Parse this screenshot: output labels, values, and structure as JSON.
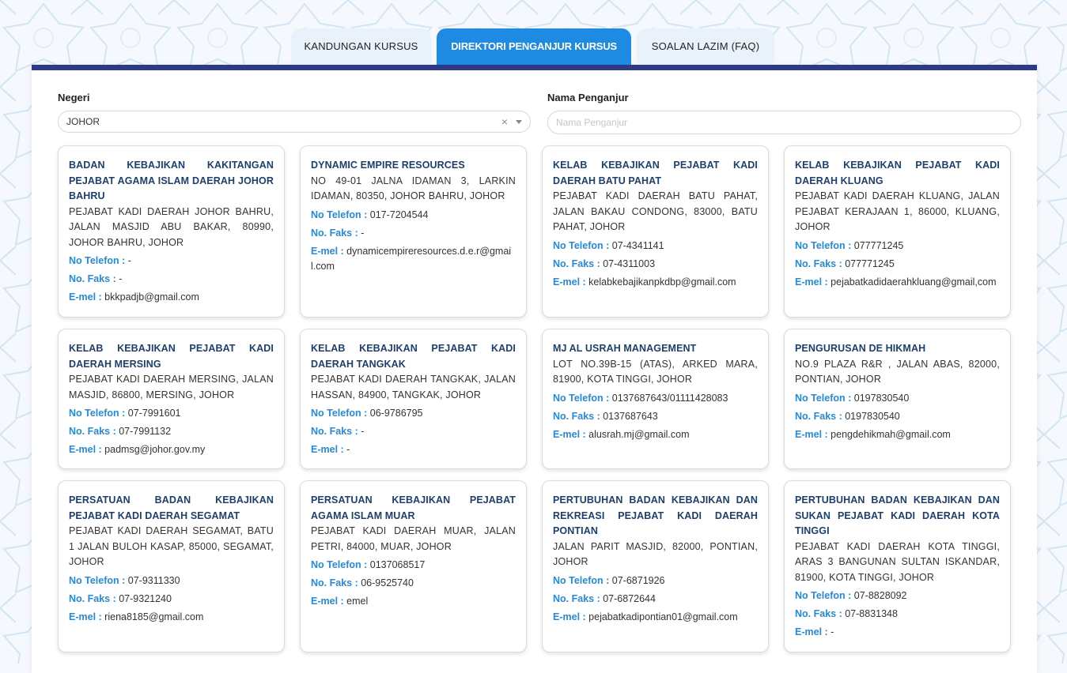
{
  "tabs": [
    {
      "label": "KANDUNGAN KURSUS",
      "active": false
    },
    {
      "label": "DIREKTORI PENGANJUR KURSUS",
      "active": true
    },
    {
      "label": "SOALAN LAZIM (FAQ)",
      "active": false
    }
  ],
  "filters": {
    "negeri_label": "Negeri",
    "negeri_value": "JOHOR",
    "clear_symbol": "×",
    "nama_label": "Nama Penganjur",
    "nama_placeholder": "Nama Penganjur"
  },
  "field_labels": {
    "telefon": "No Telefon :",
    "faks": "No. Faks :",
    "emel": "E-mel :"
  },
  "colors": {
    "tab_active": "#1f8ae2",
    "panel_bar": "#2e3a87",
    "card_title": "#1d3f6e",
    "field_label": "#2889d8"
  },
  "cards": [
    {
      "name": "BADAN KEBAJIKAN KAKITANGAN PEJABAT AGAMA ISLAM DAERAH JOHOR BAHRU",
      "address": "PEJABAT KADI DAERAH JOHOR BAHRU, JALAN MASJID ABU BAKAR, 80990, JOHOR BAHRU, JOHOR",
      "telefon": "-",
      "faks": "-",
      "emel": "bkkpadjb@gmail.com"
    },
    {
      "name": "DYNAMIC EMPIRE RESOURCES",
      "address": "NO 49-01 JALNA IDAMAN 3, LARKIN IDAMAN, 80350, JOHOR BAHRU, JOHOR",
      "telefon": "017-7204544",
      "faks": "-",
      "emel": "dynamicempireresources.d.e.r@gmail.com"
    },
    {
      "name": "KELAB KEBAJIKAN PEJABAT KADI DAERAH BATU PAHAT",
      "address": "PEJABAT KADI DAERAH BATU PAHAT, JALAN BAKAU CONDONG, 83000, BATU PAHAT, JOHOR",
      "telefon": "07-4341141",
      "faks": "07-4311003",
      "emel": "kelabkebajikanpkdbp@gmail.com"
    },
    {
      "name": "KELAB KEBAJIKAN PEJABAT KADI DAERAH KLUANG",
      "address": "PEJABAT KADI DAERAH KLUANG, JALAN PEJABAT KERAJAAN 1, 86000, KLUANG, JOHOR",
      "telefon": "077771245",
      "faks": "077771245",
      "emel": "pejabatkadidaerahkluang@gmail,com"
    },
    {
      "name": "KELAB KEBAJIKAN PEJABAT KADI DAERAH MERSING",
      "address": "PEJABAT KADI DAERAH MERSING, JALAN MASJID, 86800, MERSING, JOHOR",
      "telefon": "07-7991601",
      "faks": "07-7991132",
      "emel": "padmsg@johor.gov.my"
    },
    {
      "name": "KELAB KEBAJIKAN PEJABAT KADI DAERAH TANGKAK",
      "address": "PEJABAT KADI DAERAH TANGKAK, JALAN HASSAN, 84900, TANGKAK, JOHOR",
      "telefon": "06-9786795",
      "faks": "-",
      "emel": "-"
    },
    {
      "name": "MJ AL USRAH MANAGEMENT",
      "address": "LOT NO.39B-15 (ATAS), ARKED MARA, 81900, KOTA TINGGI, JOHOR",
      "telefon": "0137687643/01111428083",
      "faks": "0137687643",
      "emel": "alusrah.mj@gmail.com"
    },
    {
      "name": "PENGURUSAN DE HIKMAH",
      "address": "NO.9 PLAZA R&R , JALAN ABAS, 82000, PONTIAN, JOHOR",
      "telefon": "0197830540",
      "faks": "0197830540",
      "emel": "pengdehikmah@gmail.com"
    },
    {
      "name": "PERSATUAN BADAN KEBAJIKAN PEJABAT KADI DAERAH SEGAMAT",
      "address": "PEJABAT KADI DAERAH SEGAMAT, BATU 1 JALAN BULOH KASAP, 85000, SEGAMAT, JOHOR",
      "telefon": "07-9311330",
      "faks": "07-9321240",
      "emel": "riena8185@gmail.com"
    },
    {
      "name": "PERSATUAN KEBAJIKAN PEJABAT AGAMA ISLAM MUAR",
      "address": "PEJABAT KADI DAERAH MUAR, JALAN PETRI, 84000, MUAR, JOHOR",
      "telefon": "0137068517",
      "faks": "06-9525740",
      "emel": "emel"
    },
    {
      "name": "PERTUBUHAN BADAN KEBAJIKAN DAN REKREASI PEJABAT KADI DAERAH PONTIAN",
      "address": "JALAN PARIT MASJID, 82000, PONTIAN, JOHOR",
      "telefon": "07-6871926",
      "faks": "07-6872644",
      "emel": "pejabatkadipontian01@gmail.com"
    },
    {
      "name": "PERTUBUHAN BADAN KEBAJIKAN DAN SUKAN PEJABAT KADI DAERAH KOTA TINGGI",
      "address": "PEJABAT KADI DAERAH KOTA TINGGI, ARAS 3 BANGUNAN SULTAN ISKANDAR, 81900, KOTA TINGGI, JOHOR",
      "telefon": "07-8828092",
      "faks": "07-8831348",
      "emel": "-"
    }
  ]
}
